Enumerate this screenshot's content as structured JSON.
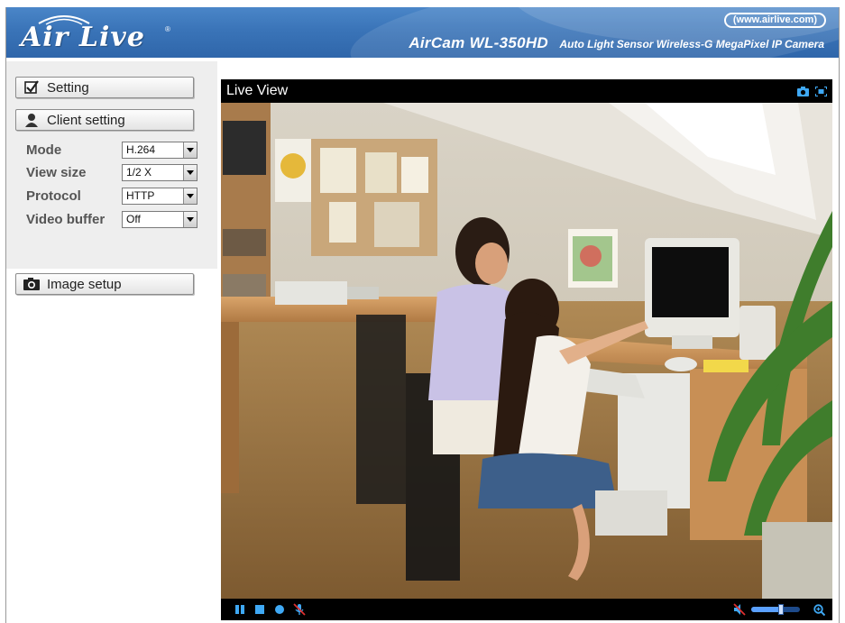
{
  "banner": {
    "logo_text": "Air Live",
    "logo_registered": "®",
    "url": "(www.airlive.com)",
    "model_name": "AirCam WL-350HD",
    "model_desc": "Auto Light Sensor Wireless-G MegaPixel IP Camera"
  },
  "sidebar": {
    "setting_label": "Setting",
    "client_setting_label": "Client setting",
    "image_setup_label": "Image setup",
    "fields": [
      {
        "label": "Mode",
        "value": "H.264"
      },
      {
        "label": "View size",
        "value": "1/2 X"
      },
      {
        "label": "Protocol",
        "value": "HTTP"
      },
      {
        "label": "Video buffer",
        "value": "Off"
      }
    ]
  },
  "live_view": {
    "title": "Live View",
    "volume_level": 0.62
  },
  "icons": {
    "setting": "checkbox-icon",
    "client": "user-icon",
    "image_setup": "camera-icon",
    "snapshot": "camera-icon",
    "fullscreen": "fullscreen-icon",
    "pause": "pause-icon",
    "stop": "stop-icon",
    "record": "record-icon",
    "mic": "mic-mute-icon",
    "speaker": "speaker-mute-icon",
    "zoom": "zoom-icon"
  },
  "colors": {
    "banner": "#3a74b8",
    "accent": "#4a86c8",
    "video_bg": "#000000"
  }
}
